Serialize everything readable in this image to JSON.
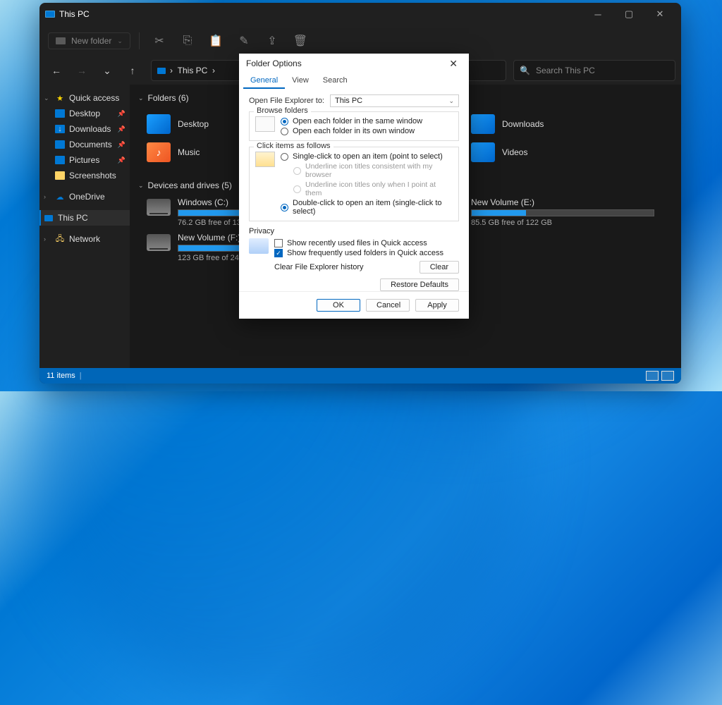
{
  "window": {
    "title": "This PC"
  },
  "toolbar": {
    "new_folder": "New folder"
  },
  "address": {
    "location": "This PC",
    "sep": "›"
  },
  "search": {
    "placeholder": "Search This PC"
  },
  "sidebar": {
    "quick_access": "Quick access",
    "items": [
      {
        "label": "Desktop",
        "pin": true
      },
      {
        "label": "Downloads",
        "pin": true
      },
      {
        "label": "Documents",
        "pin": true
      },
      {
        "label": "Pictures",
        "pin": true
      },
      {
        "label": "Screenshots",
        "pin": false
      }
    ],
    "onedrive": "OneDrive",
    "thispc": "This PC",
    "network": "Network"
  },
  "main": {
    "folders_header": "Folders (6)",
    "folders": [
      {
        "label": "Desktop"
      },
      {
        "label": "Downloads"
      },
      {
        "label": "Music"
      },
      {
        "label": "Videos"
      }
    ],
    "drives_header": "Devices and drives (5)",
    "drives": [
      {
        "name": "Windows (C:)",
        "free": "76.2 GB free of 135 GB",
        "pct": 56
      },
      {
        "name": "New Volume (E:)",
        "free": "85.5 GB free of 122 GB",
        "pct": 30
      },
      {
        "name": "New Volume (F:)",
        "free": "123 GB free of 244 GB",
        "pct": 50
      }
    ]
  },
  "status": {
    "items": "11 items"
  },
  "dialog": {
    "title": "Folder Options",
    "tabs": {
      "general": "General",
      "view": "View",
      "search": "Search"
    },
    "open_to_label": "Open File Explorer to:",
    "open_to_value": "This PC",
    "browse": {
      "legend": "Browse folders",
      "same": "Open each folder in the same window",
      "own": "Open each folder in its own window"
    },
    "click": {
      "legend": "Click items as follows",
      "single": "Single-click to open an item (point to select)",
      "u1": "Underline icon titles consistent with my browser",
      "u2": "Underline icon titles only when I point at them",
      "double": "Double-click to open an item (single-click to select)"
    },
    "privacy": {
      "legend": "Privacy",
      "recent": "Show recently used files in Quick access",
      "frequent": "Show frequently used folders in Quick access",
      "clear_label": "Clear File Explorer history",
      "clear_btn": "Clear"
    },
    "restore": "Restore Defaults",
    "ok": "OK",
    "cancel": "Cancel",
    "apply": "Apply"
  }
}
